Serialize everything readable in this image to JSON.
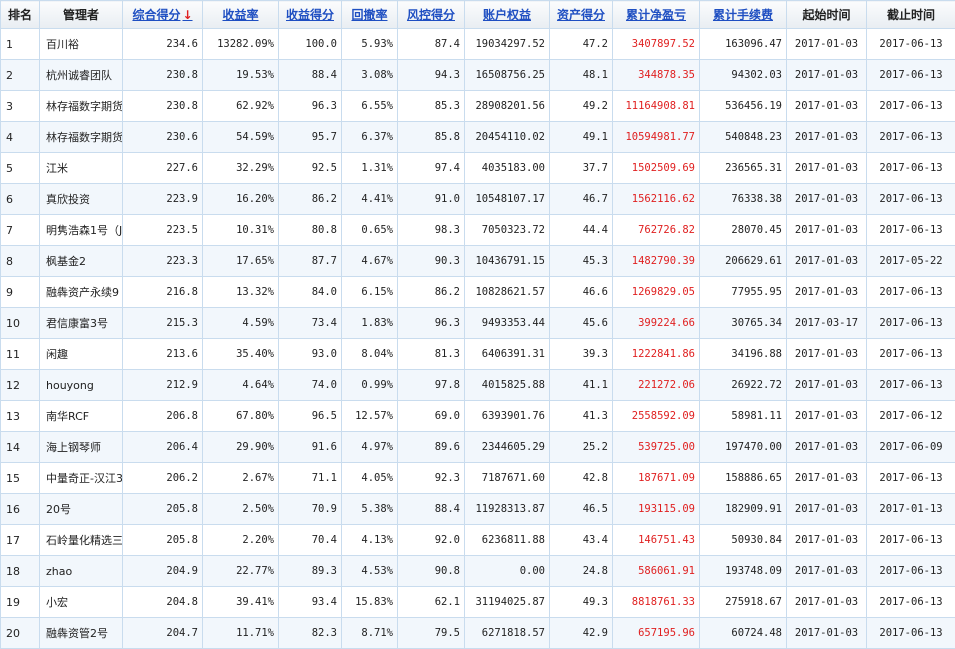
{
  "headers": [
    {
      "key": "rank",
      "label": "排名",
      "link": false
    },
    {
      "key": "manager",
      "label": "管理者",
      "link": false
    },
    {
      "key": "score",
      "label": "综合得分",
      "link": true,
      "sort_indicator": "↓"
    },
    {
      "key": "return_rate",
      "label": "收益率",
      "link": true
    },
    {
      "key": "return_score",
      "label": "收益得分",
      "link": true
    },
    {
      "key": "drawdown",
      "label": "回撤率",
      "link": true
    },
    {
      "key": "risk_score",
      "label": "风控得分",
      "link": true
    },
    {
      "key": "equity",
      "label": "账户权益",
      "link": true
    },
    {
      "key": "asset_score",
      "label": "资产得分",
      "link": true
    },
    {
      "key": "net_profit",
      "label": "累计净盈亏",
      "link": true
    },
    {
      "key": "fees",
      "label": "累计手续费",
      "link": true
    },
    {
      "key": "start",
      "label": "起始时间",
      "link": false
    },
    {
      "key": "end",
      "label": "截止时间",
      "link": false
    }
  ],
  "rows": [
    {
      "rank": "1",
      "manager": "百川裕",
      "score": "234.6",
      "return_rate": "13282.09%",
      "return_score": "100.0",
      "drawdown": "5.93%",
      "risk_score": "87.4",
      "equity": "19034297.52",
      "asset_score": "47.2",
      "net_profit": "3407897.52",
      "fees": "163096.47",
      "start": "2017-01-03",
      "end": "2017-06-13"
    },
    {
      "rank": "2",
      "manager": "杭州诚睿团队",
      "score": "230.8",
      "return_rate": "19.53%",
      "return_score": "88.4",
      "drawdown": "3.08%",
      "risk_score": "94.3",
      "equity": "16508756.25",
      "asset_score": "48.1",
      "net_profit": "344878.35",
      "fees": "94302.03",
      "start": "2017-01-03",
      "end": "2017-06-13"
    },
    {
      "rank": "3",
      "manager": "林存福数字期货",
      "score": "230.8",
      "return_rate": "62.92%",
      "return_score": "96.3",
      "drawdown": "6.55%",
      "risk_score": "85.3",
      "equity": "28908201.56",
      "asset_score": "49.2",
      "net_profit": "11164908.81",
      "fees": "536456.19",
      "start": "2017-01-03",
      "end": "2017-06-13"
    },
    {
      "rank": "4",
      "manager": "林存福数字期货",
      "score": "230.6",
      "return_rate": "54.59%",
      "return_score": "95.7",
      "drawdown": "6.37%",
      "risk_score": "85.8",
      "equity": "20454110.02",
      "asset_score": "49.1",
      "net_profit": "10594981.77",
      "fees": "540848.23",
      "start": "2017-01-03",
      "end": "2017-06-13"
    },
    {
      "rank": "5",
      "manager": "江米",
      "score": "227.6",
      "return_rate": "32.29%",
      "return_score": "92.5",
      "drawdown": "1.31%",
      "risk_score": "97.4",
      "equity": "4035183.00",
      "asset_score": "37.7",
      "net_profit": "1502509.69",
      "fees": "236565.31",
      "start": "2017-01-03",
      "end": "2017-06-13"
    },
    {
      "rank": "6",
      "manager": "真欣投资",
      "score": "223.9",
      "return_rate": "16.20%",
      "return_score": "86.2",
      "drawdown": "4.41%",
      "risk_score": "91.0",
      "equity": "10548107.17",
      "asset_score": "46.7",
      "net_profit": "1562116.62",
      "fees": "76338.38",
      "start": "2017-01-03",
      "end": "2017-06-13"
    },
    {
      "rank": "7",
      "manager": "明隽浩森1号（J",
      "score": "223.5",
      "return_rate": "10.31%",
      "return_score": "80.8",
      "drawdown": "0.65%",
      "risk_score": "98.3",
      "equity": "7050323.72",
      "asset_score": "44.4",
      "net_profit": "762726.82",
      "fees": "28070.45",
      "start": "2017-01-03",
      "end": "2017-06-13"
    },
    {
      "rank": "8",
      "manager": "枫基金2",
      "score": "223.3",
      "return_rate": "17.65%",
      "return_score": "87.7",
      "drawdown": "4.67%",
      "risk_score": "90.3",
      "equity": "10436791.15",
      "asset_score": "45.3",
      "net_profit": "1482790.39",
      "fees": "206629.61",
      "start": "2017-01-03",
      "end": "2017-05-22"
    },
    {
      "rank": "9",
      "manager": "融犇资产永续9",
      "score": "216.8",
      "return_rate": "13.32%",
      "return_score": "84.0",
      "drawdown": "6.15%",
      "risk_score": "86.2",
      "equity": "10828621.57",
      "asset_score": "46.6",
      "net_profit": "1269829.05",
      "fees": "77955.95",
      "start": "2017-01-03",
      "end": "2017-06-13"
    },
    {
      "rank": "10",
      "manager": "君信康富3号",
      "score": "215.3",
      "return_rate": "4.59%",
      "return_score": "73.4",
      "drawdown": "1.83%",
      "risk_score": "96.3",
      "equity": "9493353.44",
      "asset_score": "45.6",
      "net_profit": "399224.66",
      "fees": "30765.34",
      "start": "2017-03-17",
      "end": "2017-06-13"
    },
    {
      "rank": "11",
      "manager": "闲趣",
      "score": "213.6",
      "return_rate": "35.40%",
      "return_score": "93.0",
      "drawdown": "8.04%",
      "risk_score": "81.3",
      "equity": "6406391.31",
      "asset_score": "39.3",
      "net_profit": "1222841.86",
      "fees": "34196.88",
      "start": "2017-01-03",
      "end": "2017-06-13"
    },
    {
      "rank": "12",
      "manager": "houyong",
      "score": "212.9",
      "return_rate": "4.64%",
      "return_score": "74.0",
      "drawdown": "0.99%",
      "risk_score": "97.8",
      "equity": "4015825.88",
      "asset_score": "41.1",
      "net_profit": "221272.06",
      "fees": "26922.72",
      "start": "2017-01-03",
      "end": "2017-06-13"
    },
    {
      "rank": "13",
      "manager": "南华RCF",
      "score": "206.8",
      "return_rate": "67.80%",
      "return_score": "96.5",
      "drawdown": "12.57%",
      "risk_score": "69.0",
      "equity": "6393901.76",
      "asset_score": "41.3",
      "net_profit": "2558592.09",
      "fees": "58981.11",
      "start": "2017-01-03",
      "end": "2017-06-12"
    },
    {
      "rank": "14",
      "manager": "海上钢琴师",
      "score": "206.4",
      "return_rate": "29.90%",
      "return_score": "91.6",
      "drawdown": "4.97%",
      "risk_score": "89.6",
      "equity": "2344605.29",
      "asset_score": "25.2",
      "net_profit": "539725.00",
      "fees": "197470.00",
      "start": "2017-01-03",
      "end": "2017-06-09"
    },
    {
      "rank": "15",
      "manager": "中量奇正-汉江3",
      "score": "206.2",
      "return_rate": "2.67%",
      "return_score": "71.1",
      "drawdown": "4.05%",
      "risk_score": "92.3",
      "equity": "7187671.60",
      "asset_score": "42.8",
      "net_profit": "187671.09",
      "fees": "158886.65",
      "start": "2017-01-03",
      "end": "2017-06-13"
    },
    {
      "rank": "16",
      "manager": "20号",
      "score": "205.8",
      "return_rate": "2.50%",
      "return_score": "70.9",
      "drawdown": "5.38%",
      "risk_score": "88.4",
      "equity": "11928313.87",
      "asset_score": "46.5",
      "net_profit": "193115.09",
      "fees": "182909.91",
      "start": "2017-01-03",
      "end": "2017-01-13"
    },
    {
      "rank": "17",
      "manager": "石岭量化精选三",
      "score": "205.8",
      "return_rate": "2.20%",
      "return_score": "70.4",
      "drawdown": "4.13%",
      "risk_score": "92.0",
      "equity": "6236811.88",
      "asset_score": "43.4",
      "net_profit": "146751.43",
      "fees": "50930.84",
      "start": "2017-01-03",
      "end": "2017-06-13"
    },
    {
      "rank": "18",
      "manager": "zhao",
      "score": "204.9",
      "return_rate": "22.77%",
      "return_score": "89.3",
      "drawdown": "4.53%",
      "risk_score": "90.8",
      "equity": "0.00",
      "asset_score": "24.8",
      "net_profit": "586061.91",
      "fees": "193748.09",
      "start": "2017-01-03",
      "end": "2017-06-13"
    },
    {
      "rank": "19",
      "manager": "小宏",
      "score": "204.8",
      "return_rate": "39.41%",
      "return_score": "93.4",
      "drawdown": "15.83%",
      "risk_score": "62.1",
      "equity": "31194025.87",
      "asset_score": "49.3",
      "net_profit": "8818761.33",
      "fees": "275918.67",
      "start": "2017-01-03",
      "end": "2017-06-13"
    },
    {
      "rank": "20",
      "manager": "融犇资管2号",
      "score": "204.7",
      "return_rate": "11.71%",
      "return_score": "82.3",
      "drawdown": "8.71%",
      "risk_score": "79.5",
      "equity": "6271818.57",
      "asset_score": "42.9",
      "net_profit": "657195.96",
      "fees": "60724.48",
      "start": "2017-01-03",
      "end": "2017-06-13"
    }
  ]
}
